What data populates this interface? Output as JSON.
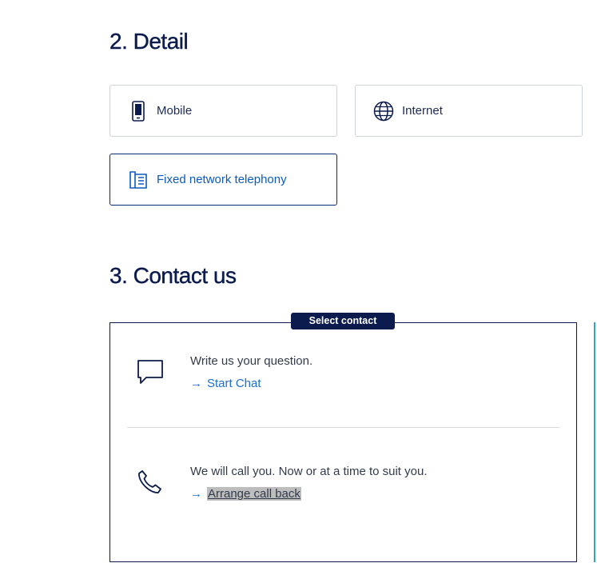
{
  "sections": {
    "detail_title": "2. Detail",
    "contact_title": "3. Contact us"
  },
  "detail_options": {
    "mobile": "Mobile",
    "internet": "Internet",
    "fixed": "Fixed network telephony"
  },
  "contact": {
    "badge": "Select contact",
    "chat": {
      "text": "Write us your question.",
      "arrow": "→",
      "link": "Start Chat"
    },
    "call": {
      "text": "We will call you. Now or at a time to suit you.",
      "arrow": "→",
      "link": "Arrange call back"
    }
  },
  "icons": {
    "mobile": "mobile-phone-icon",
    "internet": "globe-icon",
    "fixed": "fixed-phone-icon",
    "chat": "chat-bubble-icon",
    "call": "phone-handset-icon"
  },
  "colors": {
    "navy": "#0b1b4d",
    "link_blue": "#1a6fd1",
    "selected_border": "#0b2a78"
  }
}
